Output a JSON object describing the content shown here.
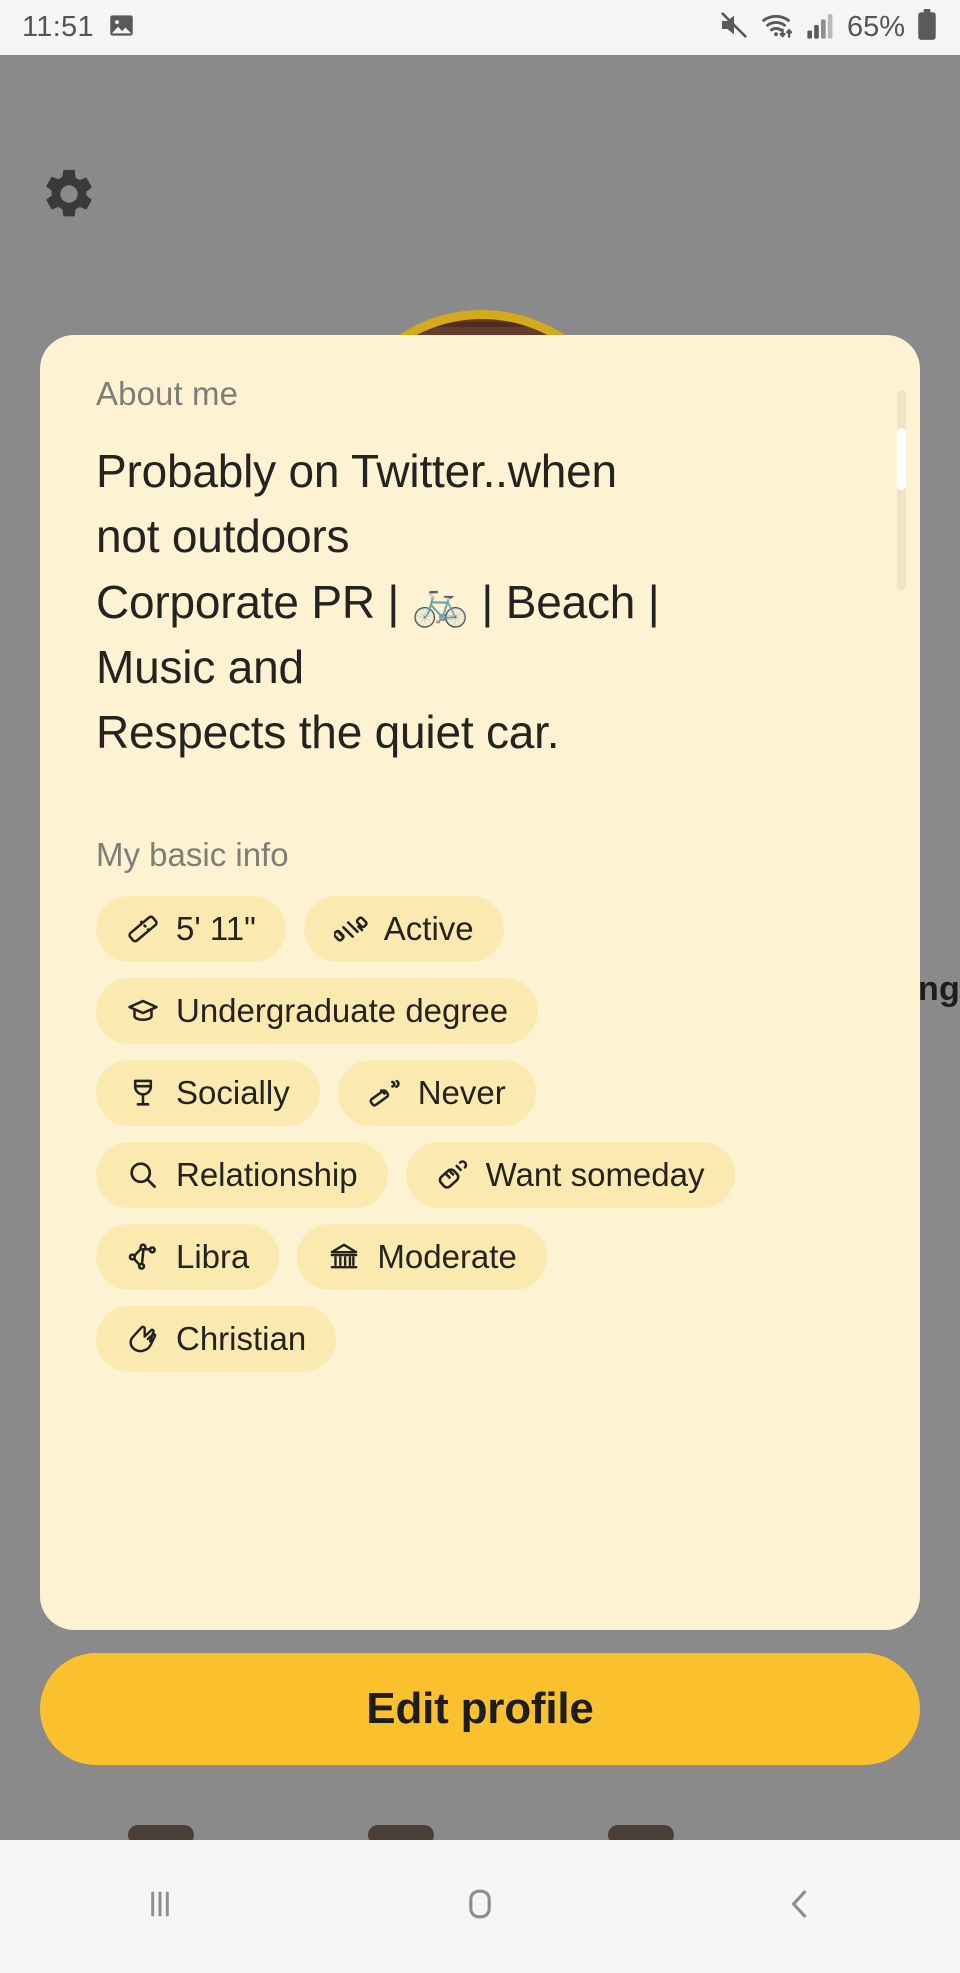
{
  "status_bar": {
    "time": "11:51",
    "icons": [
      "image-icon",
      "mute-icon",
      "wifi-icon",
      "cellular-signal-icon"
    ],
    "battery_percent": "65%"
  },
  "app": {
    "settings_icon": "gear-icon",
    "background_partial_text": "ing"
  },
  "sheet": {
    "about_label": "About me",
    "bio_lines": [
      "Probably on Twitter..when",
      "not outdoors",
      "Corporate PR | 🚲 | Beach |",
      "Music and",
      "Respects the quiet car."
    ],
    "basic_info_label": "My basic info",
    "chips": [
      {
        "icon": "ruler-icon",
        "label": "5' 11\""
      },
      {
        "icon": "dumbbell-icon",
        "label": "Active"
      },
      {
        "icon": "graduation-cap-icon",
        "label": "Undergraduate degree"
      },
      {
        "icon": "wine-glass-icon",
        "label": "Socially"
      },
      {
        "icon": "cigarette-icon",
        "label": "Never"
      },
      {
        "icon": "magnifier-icon",
        "label": "Relationship"
      },
      {
        "icon": "baby-bottle-icon",
        "label": "Want someday"
      },
      {
        "icon": "constellation-icon",
        "label": "Libra"
      },
      {
        "icon": "government-building-icon",
        "label": "Moderate"
      },
      {
        "icon": "praying-hands-icon",
        "label": "Christian"
      }
    ]
  },
  "cta": {
    "label": "Edit profile"
  },
  "nav_bar": {
    "recents": "recents-icon",
    "home": "home-icon",
    "back": "back-icon"
  },
  "colors": {
    "sheet_bg": "#fdf3d3",
    "chip_bg": "#fbeab0",
    "accent": "#fbc02d",
    "avatar_ring": "#d4a91a",
    "text": "#24231f",
    "muted_text": "#7e7e76",
    "app_bg": "#8a8a8a"
  }
}
